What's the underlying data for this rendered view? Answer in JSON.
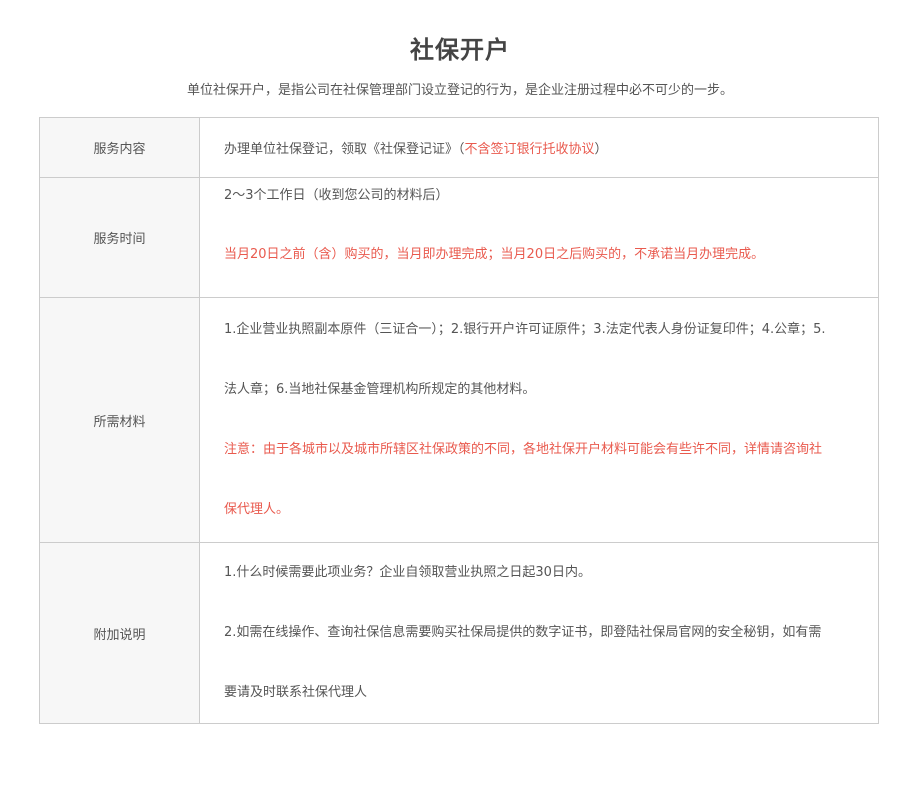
{
  "title": "社保开户",
  "subtitle": "单位社保开户，是指公司在社保管理部门设立登记的行为，是企业注册过程中必不可少的一步。",
  "rows": {
    "service": {
      "label": "服务内容",
      "text": "办理单位社保登记，领取《社保登记证》（",
      "note": "不含签订银行托收协议",
      "close": "）"
    },
    "time": {
      "label": "服务时间",
      "line1": "2～3个工作日（收到您公司的材料后）",
      "line2": "当月20日之前（含）购买的，当月即办理完成；当月20日之后购买的，不承诺当月办理完成。"
    },
    "materials": {
      "label": "所需材料",
      "line1": "1.企业营业执照副本原件（三证合一）；2.银行开户许可证原件；3.法定代表人身份证复印件；4.公章；5.",
      "line2": "法人章；6.当地社保基金管理机构所规定的其他材料。",
      "note1": "注意：由于各城市以及城市所辖区社保政策的不同，各地社保开户材料可能会有些许不同，详情请咨询社",
      "note2": "保代理人。"
    },
    "notes": {
      "label": "附加说明",
      "line1": "1.什么时候需要此项业务？企业自领取营业执照之日起30日内。",
      "line2": "2.如需在线操作、查询社保信息需要购买社保局提供的数字证书，即登陆社保局官网的安全秘钥，如有需",
      "line3": "要请及时联系社保代理人"
    }
  },
  "colors": {
    "highlight": "#e95a4e",
    "label_bg": "#f7f7f7",
    "border": "#cccccc"
  }
}
